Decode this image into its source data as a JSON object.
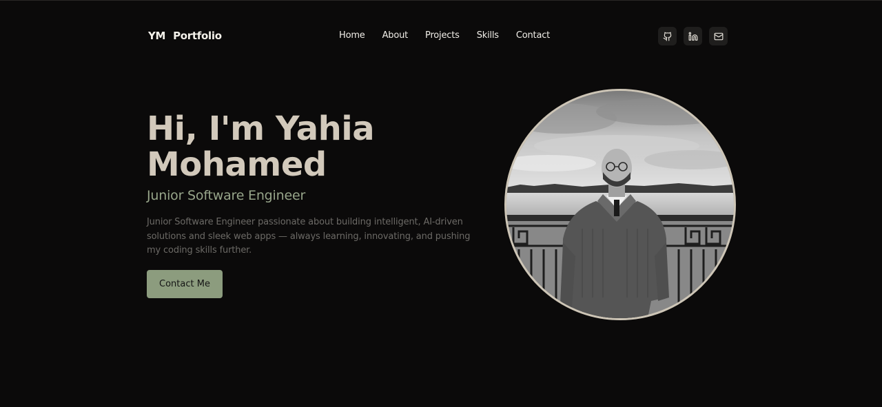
{
  "header": {
    "brand": "YM Portfolio",
    "nav": [
      "Home",
      "About",
      "Projects",
      "Skills",
      "Contact"
    ],
    "socials": [
      "github-icon",
      "linkedin-icon",
      "mail-icon"
    ]
  },
  "hero": {
    "title_line1": "Hi, I'm Yahia",
    "title_line2": "Mohamed",
    "subtitle": "Junior Software Engineer",
    "description": "Junior Software Engineer passionate about building intelligent, AI-driven solutions and sleek web apps — always learning, innovating, and pushing my coding skills further.",
    "cta_label": "Contact Me"
  },
  "colors": {
    "background": "#0b0a0a",
    "title": "#d2c9bb",
    "subtitle": "#97a58a",
    "button": "#8c9c7e",
    "frame": "#cdc5b6"
  }
}
